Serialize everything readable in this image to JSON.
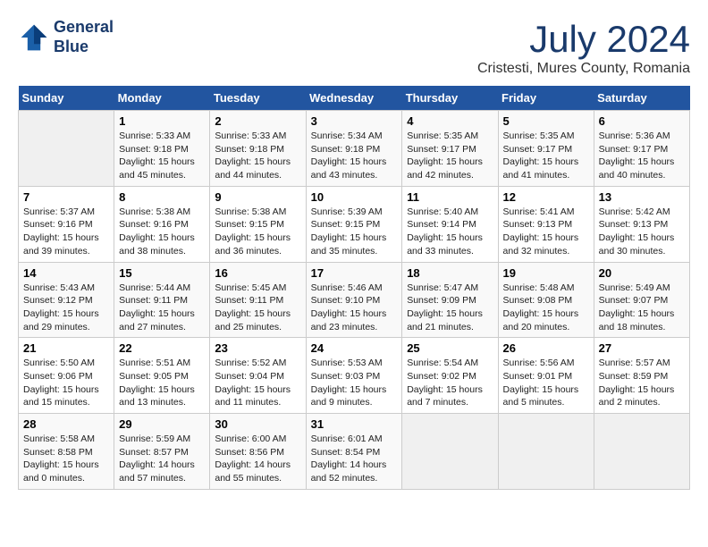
{
  "logo": {
    "line1": "General",
    "line2": "Blue"
  },
  "title": "July 2024",
  "location": "Cristesti, Mures County, Romania",
  "weekdays": [
    "Sunday",
    "Monday",
    "Tuesday",
    "Wednesday",
    "Thursday",
    "Friday",
    "Saturday"
  ],
  "weeks": [
    [
      {
        "day": "",
        "info": ""
      },
      {
        "day": "1",
        "info": "Sunrise: 5:33 AM\nSunset: 9:18 PM\nDaylight: 15 hours\nand 45 minutes."
      },
      {
        "day": "2",
        "info": "Sunrise: 5:33 AM\nSunset: 9:18 PM\nDaylight: 15 hours\nand 44 minutes."
      },
      {
        "day": "3",
        "info": "Sunrise: 5:34 AM\nSunset: 9:18 PM\nDaylight: 15 hours\nand 43 minutes."
      },
      {
        "day": "4",
        "info": "Sunrise: 5:35 AM\nSunset: 9:17 PM\nDaylight: 15 hours\nand 42 minutes."
      },
      {
        "day": "5",
        "info": "Sunrise: 5:35 AM\nSunset: 9:17 PM\nDaylight: 15 hours\nand 41 minutes."
      },
      {
        "day": "6",
        "info": "Sunrise: 5:36 AM\nSunset: 9:17 PM\nDaylight: 15 hours\nand 40 minutes."
      }
    ],
    [
      {
        "day": "7",
        "info": "Sunrise: 5:37 AM\nSunset: 9:16 PM\nDaylight: 15 hours\nand 39 minutes."
      },
      {
        "day": "8",
        "info": "Sunrise: 5:38 AM\nSunset: 9:16 PM\nDaylight: 15 hours\nand 38 minutes."
      },
      {
        "day": "9",
        "info": "Sunrise: 5:38 AM\nSunset: 9:15 PM\nDaylight: 15 hours\nand 36 minutes."
      },
      {
        "day": "10",
        "info": "Sunrise: 5:39 AM\nSunset: 9:15 PM\nDaylight: 15 hours\nand 35 minutes."
      },
      {
        "day": "11",
        "info": "Sunrise: 5:40 AM\nSunset: 9:14 PM\nDaylight: 15 hours\nand 33 minutes."
      },
      {
        "day": "12",
        "info": "Sunrise: 5:41 AM\nSunset: 9:13 PM\nDaylight: 15 hours\nand 32 minutes."
      },
      {
        "day": "13",
        "info": "Sunrise: 5:42 AM\nSunset: 9:13 PM\nDaylight: 15 hours\nand 30 minutes."
      }
    ],
    [
      {
        "day": "14",
        "info": "Sunrise: 5:43 AM\nSunset: 9:12 PM\nDaylight: 15 hours\nand 29 minutes."
      },
      {
        "day": "15",
        "info": "Sunrise: 5:44 AM\nSunset: 9:11 PM\nDaylight: 15 hours\nand 27 minutes."
      },
      {
        "day": "16",
        "info": "Sunrise: 5:45 AM\nSunset: 9:11 PM\nDaylight: 15 hours\nand 25 minutes."
      },
      {
        "day": "17",
        "info": "Sunrise: 5:46 AM\nSunset: 9:10 PM\nDaylight: 15 hours\nand 23 minutes."
      },
      {
        "day": "18",
        "info": "Sunrise: 5:47 AM\nSunset: 9:09 PM\nDaylight: 15 hours\nand 21 minutes."
      },
      {
        "day": "19",
        "info": "Sunrise: 5:48 AM\nSunset: 9:08 PM\nDaylight: 15 hours\nand 20 minutes."
      },
      {
        "day": "20",
        "info": "Sunrise: 5:49 AM\nSunset: 9:07 PM\nDaylight: 15 hours\nand 18 minutes."
      }
    ],
    [
      {
        "day": "21",
        "info": "Sunrise: 5:50 AM\nSunset: 9:06 PM\nDaylight: 15 hours\nand 15 minutes."
      },
      {
        "day": "22",
        "info": "Sunrise: 5:51 AM\nSunset: 9:05 PM\nDaylight: 15 hours\nand 13 minutes."
      },
      {
        "day": "23",
        "info": "Sunrise: 5:52 AM\nSunset: 9:04 PM\nDaylight: 15 hours\nand 11 minutes."
      },
      {
        "day": "24",
        "info": "Sunrise: 5:53 AM\nSunset: 9:03 PM\nDaylight: 15 hours\nand 9 minutes."
      },
      {
        "day": "25",
        "info": "Sunrise: 5:54 AM\nSunset: 9:02 PM\nDaylight: 15 hours\nand 7 minutes."
      },
      {
        "day": "26",
        "info": "Sunrise: 5:56 AM\nSunset: 9:01 PM\nDaylight: 15 hours\nand 5 minutes."
      },
      {
        "day": "27",
        "info": "Sunrise: 5:57 AM\nSunset: 8:59 PM\nDaylight: 15 hours\nand 2 minutes."
      }
    ],
    [
      {
        "day": "28",
        "info": "Sunrise: 5:58 AM\nSunset: 8:58 PM\nDaylight: 15 hours\nand 0 minutes."
      },
      {
        "day": "29",
        "info": "Sunrise: 5:59 AM\nSunset: 8:57 PM\nDaylight: 14 hours\nand 57 minutes."
      },
      {
        "day": "30",
        "info": "Sunrise: 6:00 AM\nSunset: 8:56 PM\nDaylight: 14 hours\nand 55 minutes."
      },
      {
        "day": "31",
        "info": "Sunrise: 6:01 AM\nSunset: 8:54 PM\nDaylight: 14 hours\nand 52 minutes."
      },
      {
        "day": "",
        "info": ""
      },
      {
        "day": "",
        "info": ""
      },
      {
        "day": "",
        "info": ""
      }
    ]
  ]
}
